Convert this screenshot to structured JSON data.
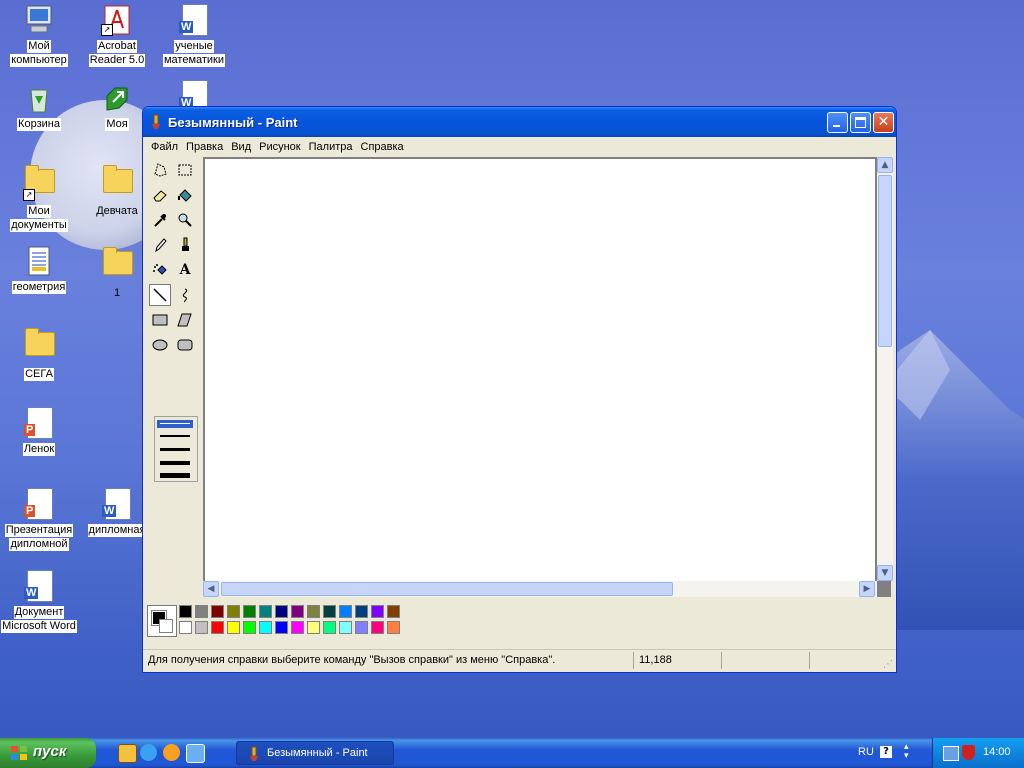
{
  "desktop": {
    "icons": [
      {
        "label_l1": "Мой",
        "label_l2": "компьютер"
      },
      {
        "label_l1": "Acrobat",
        "label_l2": "Reader 5.0"
      },
      {
        "label_l1": "ученые",
        "label_l2": "математики"
      },
      {
        "label_l1": "Корзина",
        "label_l2": ""
      },
      {
        "label_l1": "Моя",
        "label_l2": ""
      },
      {
        "label_l1": "Мои",
        "label_l2": "документы"
      },
      {
        "label_l1": "Девчата",
        "label_l2": ""
      },
      {
        "label_l1": "геометрия",
        "label_l2": ""
      },
      {
        "label_l1": "1",
        "label_l2": ""
      },
      {
        "label_l1": "СЕГА",
        "label_l2": ""
      },
      {
        "label_l1": "Ленок",
        "label_l2": ""
      },
      {
        "label_l1": "Презентация",
        "label_l2": "дипломной"
      },
      {
        "label_l1": "дипломная",
        "label_l2": ""
      },
      {
        "label_l1": "Документ",
        "label_l2": "Microsoft Word"
      }
    ]
  },
  "window": {
    "title": "Безымянный - Paint",
    "menu": [
      "Файл",
      "Правка",
      "Вид",
      "Рисунок",
      "Палитра",
      "Справка"
    ],
    "status_text": "Для получения справки выберите команду \"Вызов справки\" из меню \"Справка\".",
    "status_coord": "11,188",
    "tools": [
      "free-select",
      "rect-select",
      "eraser",
      "fill",
      "color-picker",
      "magnifier",
      "pencil",
      "brush",
      "airbrush",
      "text",
      "line",
      "curve",
      "rectangle",
      "polygon",
      "ellipse",
      "rounded-rectangle"
    ],
    "selected_tool": "line",
    "foreground_color": "#000000",
    "background_color": "#ffffff",
    "palette_row1": [
      "#000000",
      "#808080",
      "#800000",
      "#808000",
      "#008000",
      "#008080",
      "#000080",
      "#800080",
      "#808040",
      "#004040",
      "#0080ff",
      "#004080",
      "#8000ff",
      "#804000"
    ],
    "palette_row2": [
      "#ffffff",
      "#c0c0c0",
      "#ff0000",
      "#ffff00",
      "#00ff00",
      "#00ffff",
      "#0000ff",
      "#ff00ff",
      "#ffff80",
      "#00ff80",
      "#80ffff",
      "#8080ff",
      "#ff0080",
      "#ff8040"
    ]
  },
  "taskbar": {
    "start_label": "пуск",
    "task_title": "Безымянный - Paint",
    "language": "RU",
    "clock": "14:00"
  }
}
